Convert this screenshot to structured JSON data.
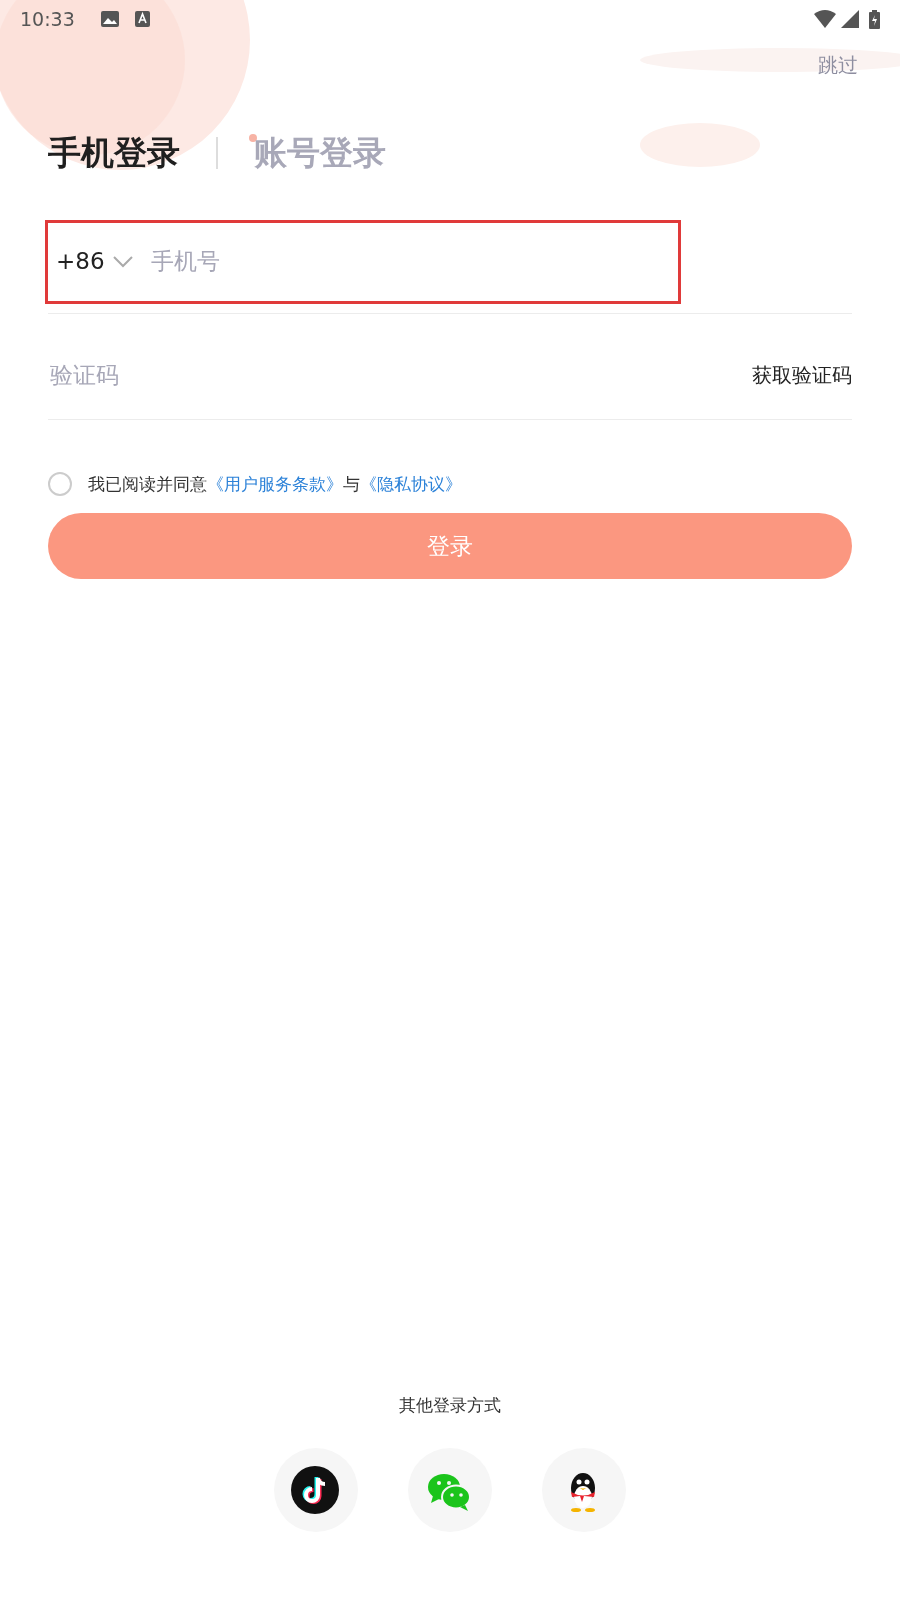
{
  "status_bar": {
    "time": "10:33"
  },
  "skip": "跳过",
  "tabs": [
    {
      "label": "手机登录",
      "selected": true
    },
    {
      "label": "账号登录",
      "selected": false
    }
  ],
  "phone": {
    "country_code": "+86",
    "placeholder": "手机号",
    "highlighted": true
  },
  "code": {
    "placeholder": "验证码",
    "action": "获取验证码"
  },
  "agreement": {
    "checked": false,
    "text": "我已阅读并同意",
    "link1": "《用户服务条款》",
    "joiner": "与",
    "link2": "《隐私协议》"
  },
  "login_button": "登录",
  "other_title": "其他登录方式",
  "login_options": [
    {
      "kind": "music"
    },
    {
      "kind": "chat"
    },
    {
      "kind": "penguin"
    }
  ]
}
